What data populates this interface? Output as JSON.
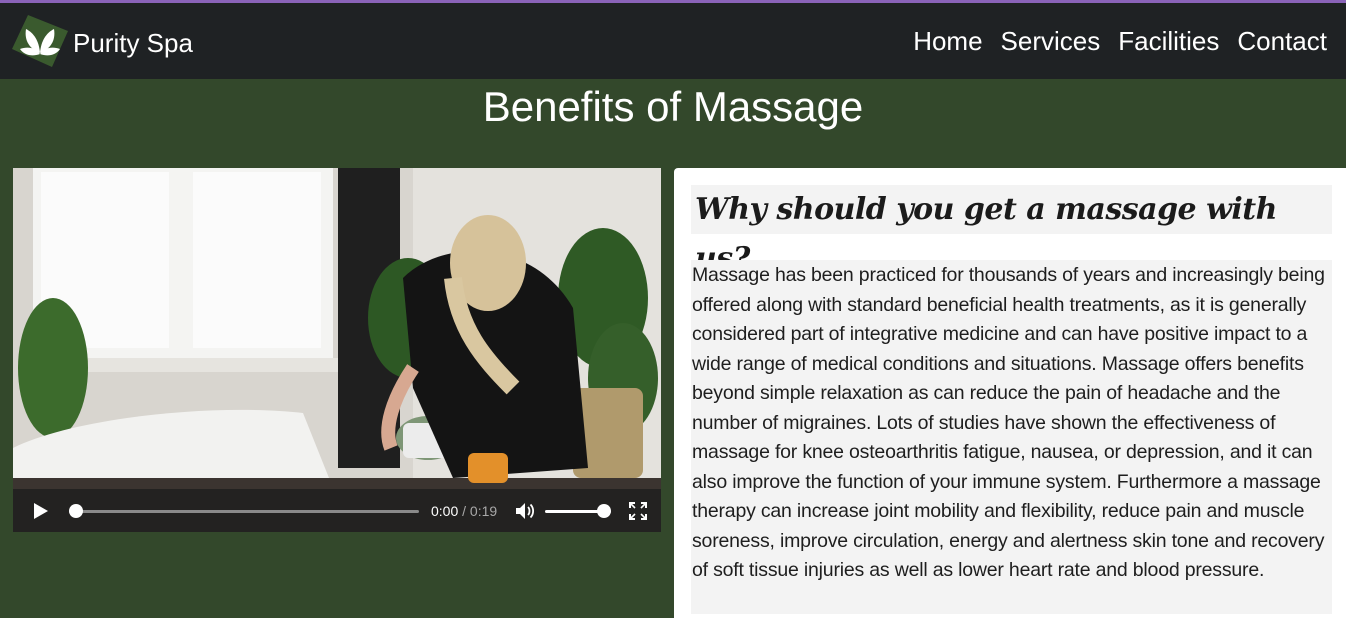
{
  "brand": {
    "name": "Purity Spa",
    "logo_icon": "lotus-leaf-icon"
  },
  "nav": {
    "items": [
      {
        "label": "Home"
      },
      {
        "label": "Services"
      },
      {
        "label": "Facilities"
      },
      {
        "label": "Contact"
      }
    ]
  },
  "page": {
    "title": "Benefits of Massage"
  },
  "video": {
    "current_time": "0:00",
    "duration": "/ 0:19",
    "progress": 0,
    "volume": 1.0,
    "icons": [
      "play-icon",
      "volume-icon",
      "fullscreen-icon"
    ]
  },
  "content": {
    "heading": "Why should you get a massage with us?",
    "body": "Massage has been practiced for thousands of years and increasingly being offered along with standard beneficial health treatments, as it is generally considered part of integrative medicine and can have positive impact to a wide range of medical conditions and situations. Massage offers benefits beyond simple relaxation as can reduce the pain of headache and the number of migraines. Lots of studies have shown the effectiveness of massage for knee osteoarthritis fatigue, nausea, or depression, and it can also improve the function of your immune system. Furthermore a massage therapy can increase joint mobility and flexibility, reduce pain and muscle soreness, improve circulation, energy and alertness skin tone and recovery of soft tissue injuries as well as lower heart rate and blood pressure."
  },
  "colors": {
    "top_accent": "#8a63b8",
    "navbar_bg": "#1f2224",
    "page_bg": "#33482b",
    "panel_bg": "#ffffff",
    "text_block_bg": "#f3f3f3"
  }
}
